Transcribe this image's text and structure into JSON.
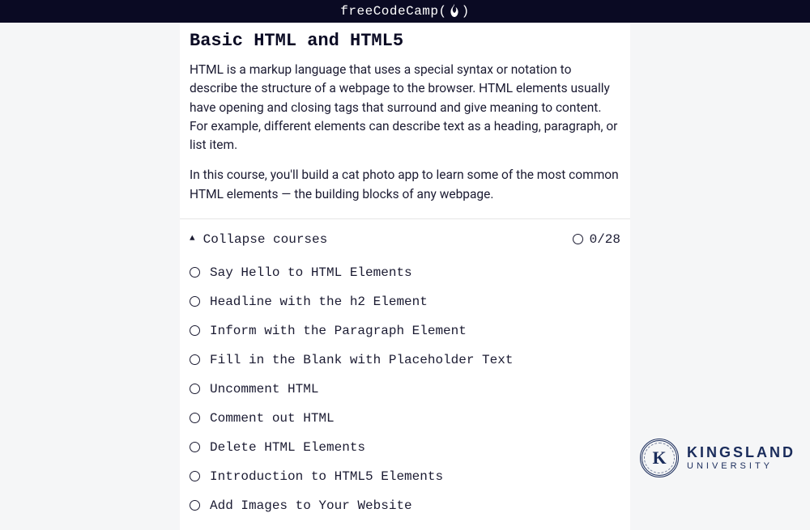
{
  "header": {
    "brand_left": "freeCodeCamp(",
    "brand_right": ")"
  },
  "course": {
    "title": "Basic HTML and HTML5",
    "desc1": "HTML is a markup language that uses a special syntax or notation to describe the structure of a webpage to the browser. HTML elements usually have opening and closing tags that surround and give meaning to content. For example, different elements can describe text as a heading, paragraph, or list item.",
    "desc2": "In this course, you'll build a cat photo app to learn some of the most common HTML elements — the building blocks of any webpage.",
    "collapse_label": "Collapse courses",
    "progress": "0/28",
    "lessons": [
      "Say Hello to HTML Elements",
      "Headline with the h2 Element",
      "Inform with the Paragraph Element",
      "Fill in the Blank with Placeholder Text",
      "Uncomment HTML",
      "Comment out HTML",
      "Delete HTML Elements",
      "Introduction to HTML5 Elements",
      "Add Images to Your Website"
    ]
  },
  "footer_logo": {
    "letter": "K",
    "line1": "KINGSLAND",
    "line2": "UNIVERSITY"
  }
}
